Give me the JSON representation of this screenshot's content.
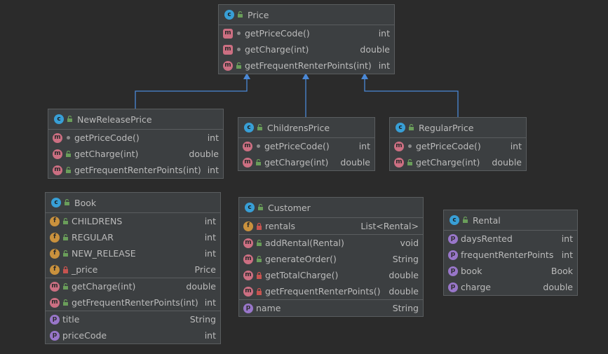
{
  "classes": {
    "price": {
      "name": "Price",
      "methods": [
        {
          "name": "getPriceCode()",
          "type": "int"
        },
        {
          "name": "getCharge(int)",
          "type": "double"
        },
        {
          "name": "getFrequentRenterPoints(int)",
          "type": "int"
        }
      ]
    },
    "new_release_price": {
      "name": "NewReleasePrice",
      "methods": [
        {
          "name": "getPriceCode()",
          "type": "int"
        },
        {
          "name": "getCharge(int)",
          "type": "double"
        },
        {
          "name": "getFrequentRenterPoints(int)",
          "type": "int"
        }
      ]
    },
    "childrens_price": {
      "name": "ChildrensPrice",
      "methods": [
        {
          "name": "getPriceCode()",
          "type": "int"
        },
        {
          "name": "getCharge(int)",
          "type": "double"
        }
      ]
    },
    "regular_price": {
      "name": "RegularPrice",
      "methods": [
        {
          "name": "getPriceCode()",
          "type": "int"
        },
        {
          "name": "getCharge(int)",
          "type": "double"
        }
      ]
    },
    "book": {
      "name": "Book",
      "fields": [
        {
          "name": "CHILDRENS",
          "type": "int"
        },
        {
          "name": "REGULAR",
          "type": "int"
        },
        {
          "name": "NEW_RELEASE",
          "type": "int"
        },
        {
          "name": "_price",
          "type": "Price"
        }
      ],
      "methods": [
        {
          "name": "getCharge(int)",
          "type": "double"
        },
        {
          "name": "getFrequentRenterPoints(int)",
          "type": "int"
        }
      ],
      "properties": [
        {
          "name": "title",
          "type": "String"
        },
        {
          "name": "priceCode",
          "type": "int"
        }
      ]
    },
    "customer": {
      "name": "Customer",
      "fields": [
        {
          "name": "rentals",
          "type": "List<Rental>"
        }
      ],
      "methods": [
        {
          "name": "addRental(Rental)",
          "type": "void"
        },
        {
          "name": "generateOrder()",
          "type": "String"
        },
        {
          "name": "getTotalCharge()",
          "type": "double"
        },
        {
          "name": "getFrequentRenterPoints()",
          "type": "double"
        }
      ],
      "properties": [
        {
          "name": "name",
          "type": "String"
        }
      ]
    },
    "rental": {
      "name": "Rental",
      "properties": [
        {
          "name": "daysRented",
          "type": "int"
        },
        {
          "name": "frequentRenterPoints",
          "type": "int"
        },
        {
          "name": "book",
          "type": "Book"
        },
        {
          "name": "charge",
          "type": "double"
        }
      ]
    }
  },
  "icons": {
    "class": "class-icon",
    "method": "method-icon",
    "field": "field-icon",
    "property": "property-icon",
    "public": "public-visibility-icon",
    "private": "private-lock-icon",
    "package": "package-dot-icon"
  },
  "colors": {
    "background": "#2b2b2b",
    "box": "#3c3f41",
    "arrow": "#4a88d6",
    "method_badge": "#cc6f82",
    "field_badge": "#c9913d",
    "property_badge": "#9876c9",
    "class_badge": "#389fd6"
  }
}
